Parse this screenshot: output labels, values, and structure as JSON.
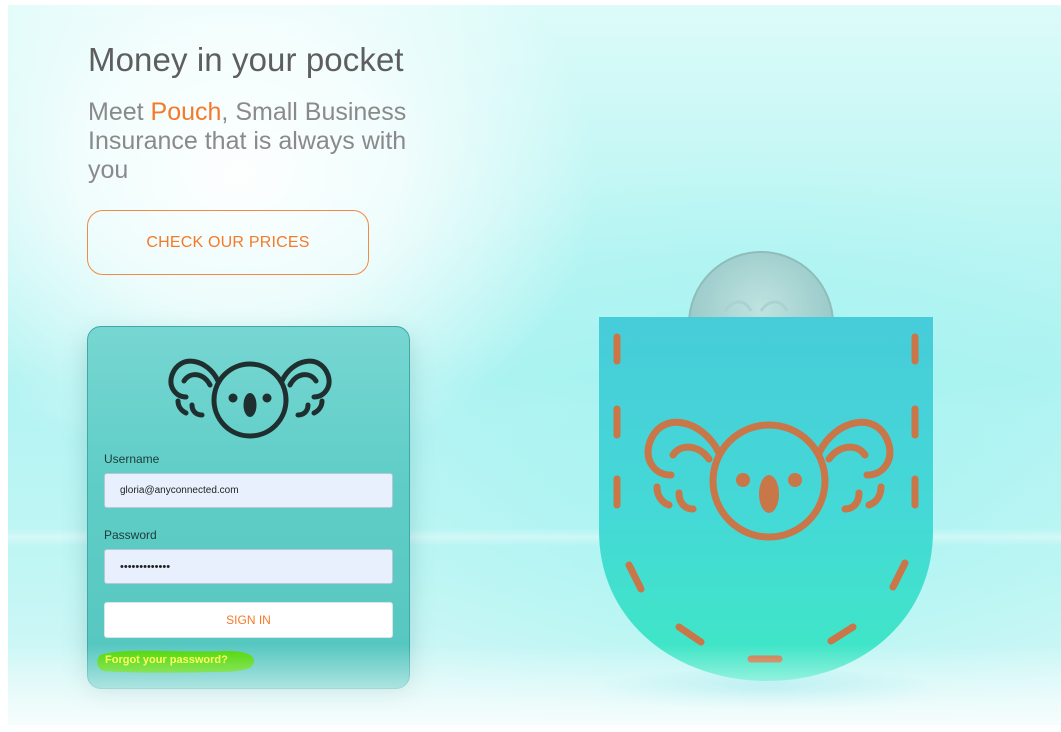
{
  "hero": {
    "headline": "Money in your pocket",
    "subline_prefix": "Meet ",
    "brand_name": "Pouch",
    "subline_suffix": ", Small Business Insurance that is always with you",
    "cta_label": "CHECK OUR PRICES"
  },
  "login": {
    "logo_icon": "koala-icon",
    "username_label": "Username",
    "username_value": "gloria@anyconnected.com",
    "password_label": "Password",
    "password_value": "•••••••••••••",
    "signin_label": "SIGN IN",
    "forgot_label": "Forgot your password?"
  },
  "illustration": {
    "icon": "pocket-with-coin-koala-icon"
  },
  "colors": {
    "accent": "#f47a2a",
    "card": "#5ecdc6",
    "highlight": "#4cd600",
    "link": "#ffff33",
    "background": "#aef3f1"
  }
}
